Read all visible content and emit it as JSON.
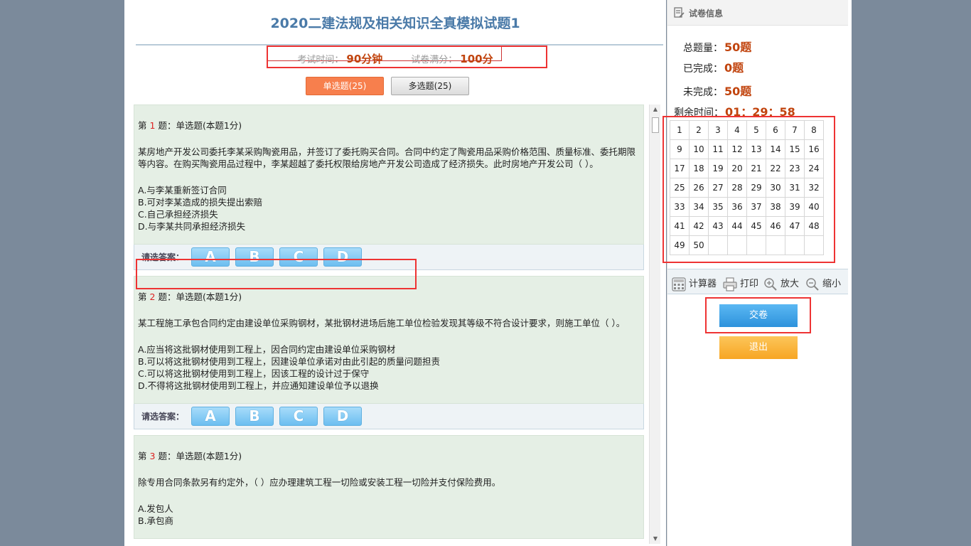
{
  "exam": {
    "title": "2020二建法规及相关知识全真模拟试题1",
    "time_label": "考试时间：",
    "time_value": "90分钟",
    "score_label": "试卷满分：",
    "score_value": "100分"
  },
  "tabs": [
    {
      "label": "单选题(25)",
      "active": true
    },
    {
      "label": "多选题(25)",
      "active": false
    }
  ],
  "answer_label": "请选答案：",
  "answer_options": [
    "A",
    "B",
    "C",
    "D"
  ],
  "questions": [
    {
      "prefix": "第",
      "number": "1",
      "suffix": "题：单选题(本题1分)",
      "stem": "某房地产开发公司委托李某采购陶瓷用品，并签订了委托购买合同。合同中约定了陶瓷用品采购价格范围、质量标准、委托期限等内容。在购买陶瓷用品过程中，李某超越了委托权限给房地产开发公司造成了经济损失。此时房地产开发公司（ ）。",
      "options": [
        "A.与李某重新签订合同",
        "B.可对李某造成的损失提出索赔",
        "C.自己承担经济损失",
        "D.与李某共同承担经济损失"
      ]
    },
    {
      "prefix": "第",
      "number": "2",
      "suffix": "题：单选题(本题1分)",
      "stem": "某工程施工承包合同约定由建设单位采购钢材，某批钢材进场后施工单位检验发现其等级不符合设计要求，则施工单位（ ）。",
      "options": [
        "A.应当将这批钢材使用到工程上，因合同约定由建设单位采购钢材",
        "B.可以将这批钢材使用到工程上，因建设单位承诺对由此引起的质量问题担责",
        "C.可以将这批钢材使用到工程上，因该工程的设计过于保守",
        "D.不得将这批钢材使用到工程上，并应通知建设单位予以退换"
      ]
    },
    {
      "prefix": "第",
      "number": "3",
      "suffix": "题：单选题(本题1分)",
      "stem": "除专用合同条款另有约定外，（ ）应办理建筑工程一切险或安装工程一切险并支付保险费用。",
      "options": [
        "A.发包人",
        "B.承包商"
      ]
    }
  ],
  "sidebar": {
    "header": "试卷信息",
    "total_label": "总题量：",
    "total_value": "50题",
    "done_label": "已完成：",
    "done_value": "0题",
    "undone_label": "未完成：",
    "undone_value": "50题",
    "remain_label": "剩余时间：",
    "remain_value": "01：29：58",
    "question_numbers": [
      "1",
      "2",
      "3",
      "4",
      "5",
      "6",
      "7",
      "8",
      "9",
      "10",
      "11",
      "12",
      "13",
      "14",
      "15",
      "16",
      "17",
      "18",
      "19",
      "20",
      "21",
      "22",
      "23",
      "24",
      "25",
      "26",
      "27",
      "28",
      "29",
      "30",
      "31",
      "32",
      "33",
      "34",
      "35",
      "36",
      "37",
      "38",
      "39",
      "40",
      "41",
      "42",
      "43",
      "44",
      "45",
      "46",
      "47",
      "48",
      "49",
      "50"
    ]
  },
  "toolbar": {
    "calculator": "计算器",
    "print": "打印",
    "zoom_in": "放大",
    "zoom_out": "缩小"
  },
  "buttons": {
    "submit": "交卷",
    "exit": "退出"
  },
  "colors": {
    "highlight_red": "#e33333",
    "active_tab": "#f77f4d",
    "value_text": "#c1440e",
    "answer_button": "#6cbef0",
    "submit_button": "#2d92dc",
    "exit_button": "#f7a623"
  }
}
